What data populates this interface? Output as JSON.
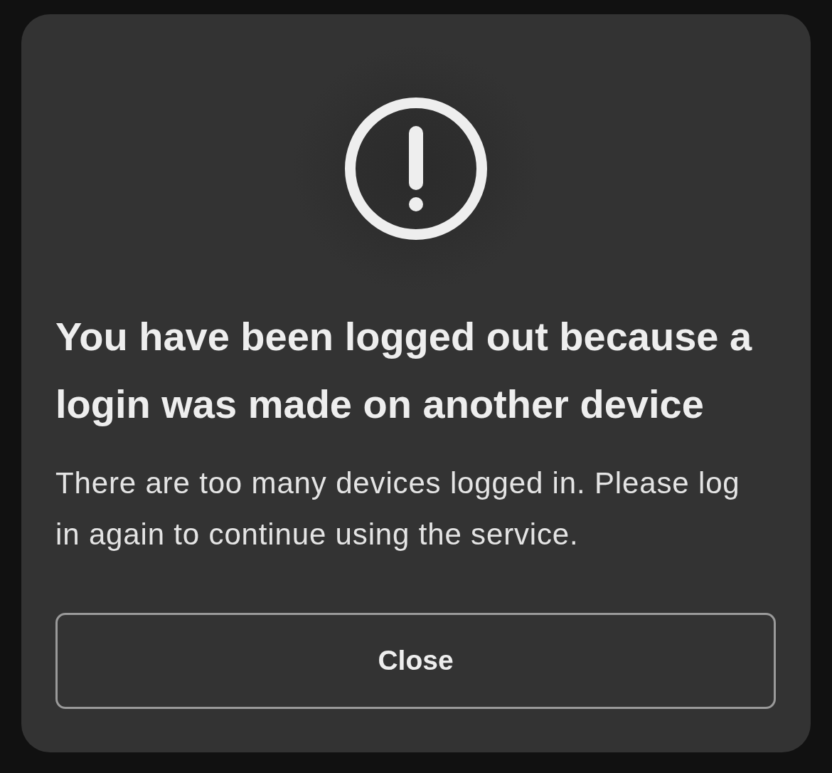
{
  "dialog": {
    "title": "You have been logged out because a login was made on another device",
    "message": "There are too many devices logged in. Please log in again to continue using the service.",
    "buttons": [
      {
        "label": "Close",
        "kind": "outline"
      }
    ]
  }
}
